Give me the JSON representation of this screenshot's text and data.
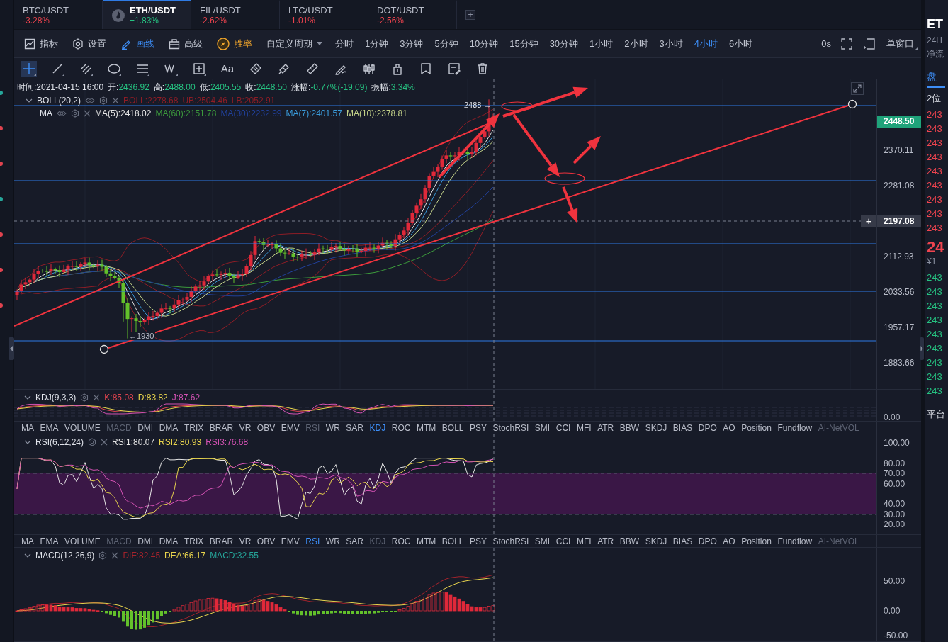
{
  "side_markers": [
    {
      "color": "#26a69a"
    },
    {
      "color": "#e0434f"
    },
    {
      "color": "#e0434f"
    },
    {
      "color": "#26a69a"
    },
    {
      "color": "#e0434f"
    },
    {
      "color": "#e0434f"
    },
    {
      "color": "#e0434f"
    }
  ],
  "tabs": [
    {
      "pair": "BTC/USDT",
      "change": "-3.28%",
      "color": "#f0444f",
      "selected": false
    },
    {
      "pair": "ETH/USDT",
      "change": "+1.83%",
      "color": "#26c281",
      "selected": true
    },
    {
      "pair": "FIL/USDT",
      "change": "-2.62%",
      "color": "#f0444f",
      "selected": false
    },
    {
      "pair": "LTC/USDT",
      "change": "-1.01%",
      "color": "#f0444f",
      "selected": false
    },
    {
      "pair": "DOT/USDT",
      "change": "-2.56%",
      "color": "#f0444f",
      "selected": false
    }
  ],
  "add_tab": "+",
  "toolbar": {
    "tools": [
      {
        "label": "指标",
        "kind": "indicator",
        "selected": false
      },
      {
        "label": "设置",
        "kind": "settings",
        "selected": false
      },
      {
        "label": "画线",
        "kind": "draw",
        "selected": true
      },
      {
        "label": "高级",
        "kind": "advanced",
        "selected": false
      },
      {
        "label": "胜率",
        "kind": "winrate",
        "selected": false
      }
    ],
    "custom_period": "自定义周期",
    "periods": [
      {
        "label": "分时",
        "selected": false
      },
      {
        "label": "1分钟",
        "selected": false
      },
      {
        "label": "3分钟",
        "selected": false
      },
      {
        "label": "5分钟",
        "selected": false
      },
      {
        "label": "10分钟",
        "selected": false
      },
      {
        "label": "15分钟",
        "selected": false
      },
      {
        "label": "30分钟",
        "selected": false
      },
      {
        "label": "1小时",
        "selected": false
      },
      {
        "label": "2小时",
        "selected": false
      },
      {
        "label": "3小时",
        "selected": false
      },
      {
        "label": "4小时",
        "selected": true
      },
      {
        "label": "6小时",
        "selected": false
      }
    ],
    "countdown": "0s",
    "window_mode": "单窗口"
  },
  "draw_toolbar": {
    "crosshair_selected": true,
    "text_tool": "Aa"
  },
  "main_chart": {
    "info": {
      "time": "时间:2021-04-15 16:00",
      "fields": [
        {
          "label": "开:",
          "value": "2436.92"
        },
        {
          "label": "高:",
          "value": "2488.00"
        },
        {
          "label": "低:",
          "value": "2405.55"
        },
        {
          "label": "收:",
          "value": "2448.50"
        },
        {
          "label": "涨幅:",
          "value": "-0.77%(-19.09)"
        },
        {
          "label": "振幅:",
          "value": "3.34%"
        }
      ]
    },
    "boll": {
      "name": "BOLL(20,2)",
      "values": [
        {
          "text": "BOLL:2278.68",
          "color": "#8e1d26"
        },
        {
          "text": "UB:2504.46",
          "color": "#8e1d26"
        },
        {
          "text": "LB:2052.91",
          "color": "#8e1d26"
        }
      ]
    },
    "ma": {
      "name": "MA",
      "values": [
        {
          "text": "MA(5):2418.02",
          "color": "#e6e6e6"
        },
        {
          "text": "MA(60):2151.78",
          "color": "#3c9a3c"
        },
        {
          "text": "MA(30):2232.99",
          "color": "#21409a"
        },
        {
          "text": "MA(7):2401.57",
          "color": "#3a9ad9"
        },
        {
          "text": "MA(10):2378.81",
          "color": "#c5d48a"
        }
      ]
    },
    "high_label": "2488 →",
    "low_label": "←1930",
    "price_ticks": [
      "2370.11",
      "2281.08",
      "2112.93",
      "2033.56",
      "1957.17",
      "1883.66"
    ],
    "last_price": "2448.50",
    "crosshair_price": "2197.08",
    "crosshair_button": "+"
  },
  "kdj": {
    "name": "KDJ(9,3,3)",
    "values": [
      {
        "text": "K:85.08",
        "color": "#e0434f"
      },
      {
        "text": "D:83.82",
        "color": "#e8d44d"
      },
      {
        "text": "J:87.62",
        "color": "#d452b4"
      }
    ],
    "ticks": [
      "0.00"
    ]
  },
  "indicator_tabs_1": [
    {
      "label": "MA",
      "selected": false,
      "disabled": false
    },
    {
      "label": "EMA",
      "selected": false,
      "disabled": false
    },
    {
      "label": "VOLUME",
      "selected": false,
      "disabled": false
    },
    {
      "label": "MACD",
      "selected": false,
      "disabled": true
    },
    {
      "label": "DMI",
      "selected": false,
      "disabled": false
    },
    {
      "label": "DMA",
      "selected": false,
      "disabled": false
    },
    {
      "label": "TRIX",
      "selected": false,
      "disabled": false
    },
    {
      "label": "BRAR",
      "selected": false,
      "disabled": false
    },
    {
      "label": "VR",
      "selected": false,
      "disabled": false
    },
    {
      "label": "OBV",
      "selected": false,
      "disabled": false
    },
    {
      "label": "EMV",
      "selected": false,
      "disabled": false
    },
    {
      "label": "RSI",
      "selected": false,
      "disabled": true
    },
    {
      "label": "WR",
      "selected": false,
      "disabled": false
    },
    {
      "label": "SAR",
      "selected": false,
      "disabled": false
    },
    {
      "label": "KDJ",
      "selected": true,
      "disabled": false
    },
    {
      "label": "ROC",
      "selected": false,
      "disabled": false
    },
    {
      "label": "MTM",
      "selected": false,
      "disabled": false
    },
    {
      "label": "BOLL",
      "selected": false,
      "disabled": false
    },
    {
      "label": "PSY",
      "selected": false,
      "disabled": false
    },
    {
      "label": "StochRSI",
      "selected": false,
      "disabled": false
    },
    {
      "label": "SMI",
      "selected": false,
      "disabled": false
    },
    {
      "label": "CCI",
      "selected": false,
      "disabled": false
    },
    {
      "label": "MFI",
      "selected": false,
      "disabled": false
    },
    {
      "label": "ATR",
      "selected": false,
      "disabled": false
    },
    {
      "label": "BBW",
      "selected": false,
      "disabled": false
    },
    {
      "label": "SKDJ",
      "selected": false,
      "disabled": false
    },
    {
      "label": "BIAS",
      "selected": false,
      "disabled": false
    },
    {
      "label": "DPO",
      "selected": false,
      "disabled": false
    },
    {
      "label": "AO",
      "selected": false,
      "disabled": false
    },
    {
      "label": "Position",
      "selected": false,
      "disabled": false
    },
    {
      "label": "Fundflow",
      "selected": false,
      "disabled": false
    },
    {
      "label": "AI-NetVOL",
      "selected": false,
      "disabled": true
    }
  ],
  "rsi": {
    "name": "RSI(6,12,24)",
    "values": [
      {
        "text": "RSI1:80.07",
        "color": "#e6e6e6"
      },
      {
        "text": "RSI2:80.93",
        "color": "#e8d44d"
      },
      {
        "text": "RSI3:76.68",
        "color": "#d452b4"
      }
    ],
    "ticks": [
      "100.00",
      "80.00",
      "70.00",
      "60.00",
      "40.00",
      "30.00",
      "20.00"
    ]
  },
  "indicator_tabs_2": [
    {
      "label": "MA",
      "selected": false,
      "disabled": false
    },
    {
      "label": "EMA",
      "selected": false,
      "disabled": false
    },
    {
      "label": "VOLUME",
      "selected": false,
      "disabled": false
    },
    {
      "label": "MACD",
      "selected": false,
      "disabled": true
    },
    {
      "label": "DMI",
      "selected": false,
      "disabled": false
    },
    {
      "label": "DMA",
      "selected": false,
      "disabled": false
    },
    {
      "label": "TRIX",
      "selected": false,
      "disabled": false
    },
    {
      "label": "BRAR",
      "selected": false,
      "disabled": false
    },
    {
      "label": "VR",
      "selected": false,
      "disabled": false
    },
    {
      "label": "OBV",
      "selected": false,
      "disabled": false
    },
    {
      "label": "EMV",
      "selected": false,
      "disabled": false
    },
    {
      "label": "RSI",
      "selected": true,
      "disabled": false
    },
    {
      "label": "WR",
      "selected": false,
      "disabled": false
    },
    {
      "label": "SAR",
      "selected": false,
      "disabled": false
    },
    {
      "label": "KDJ",
      "selected": false,
      "disabled": true
    },
    {
      "label": "ROC",
      "selected": false,
      "disabled": false
    },
    {
      "label": "MTM",
      "selected": false,
      "disabled": false
    },
    {
      "label": "BOLL",
      "selected": false,
      "disabled": false
    },
    {
      "label": "PSY",
      "selected": false,
      "disabled": false
    },
    {
      "label": "StochRSI",
      "selected": false,
      "disabled": false
    },
    {
      "label": "SMI",
      "selected": false,
      "disabled": false
    },
    {
      "label": "CCI",
      "selected": false,
      "disabled": false
    },
    {
      "label": "MFI",
      "selected": false,
      "disabled": false
    },
    {
      "label": "ATR",
      "selected": false,
      "disabled": false
    },
    {
      "label": "BBW",
      "selected": false,
      "disabled": false
    },
    {
      "label": "SKDJ",
      "selected": false,
      "disabled": false
    },
    {
      "label": "BIAS",
      "selected": false,
      "disabled": false
    },
    {
      "label": "DPO",
      "selected": false,
      "disabled": false
    },
    {
      "label": "AO",
      "selected": false,
      "disabled": false
    },
    {
      "label": "Position",
      "selected": false,
      "disabled": false
    },
    {
      "label": "Fundflow",
      "selected": false,
      "disabled": false
    },
    {
      "label": "AI-NetVOL",
      "selected": false,
      "disabled": true
    }
  ],
  "macd": {
    "name": "MACD(12,26,9)",
    "values": [
      {
        "text": "DIF:82.45",
        "color": "#a3232c"
      },
      {
        "text": "DEA:66.17",
        "color": "#e8d44d"
      },
      {
        "text": "MACD:32.55",
        "color": "#26a69a"
      }
    ],
    "ticks": [
      "50.00",
      "0.00",
      "-50.00"
    ]
  },
  "side_panel": {
    "symbol": "ET",
    "label_24h": "24H",
    "net_flow": "净流",
    "tab": "盘",
    "precision": "2位",
    "asks": [
      "243",
      "243",
      "243",
      "243",
      "243",
      "243",
      "243",
      "243",
      "243"
    ],
    "last": "24",
    "cny": "¥1",
    "bids": [
      "243",
      "243",
      "243",
      "243",
      "243",
      "243",
      "243",
      "243",
      "243"
    ],
    "footer": "平台"
  }
}
